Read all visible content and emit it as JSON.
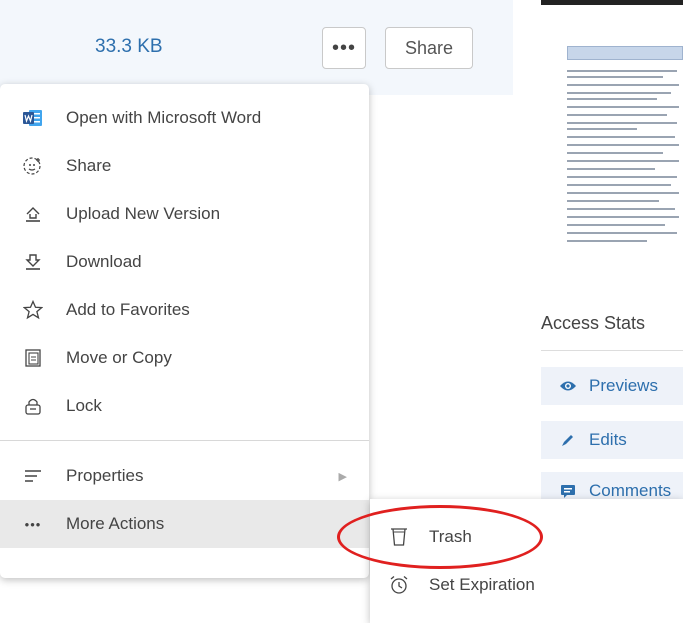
{
  "header": {
    "file_size": "33.3 KB",
    "more_label": "•••",
    "share_label": "Share"
  },
  "menu": {
    "items": [
      {
        "label": "Open with Microsoft Word",
        "icon": "word-icon"
      },
      {
        "label": "Share",
        "icon": "share-people-icon"
      },
      {
        "label": "Upload New Version",
        "icon": "upload-icon"
      },
      {
        "label": "Download",
        "icon": "download-icon"
      },
      {
        "label": "Add to Favorites",
        "icon": "star-icon"
      },
      {
        "label": "Move or Copy",
        "icon": "move-copy-icon"
      },
      {
        "label": "Lock",
        "icon": "lock-icon"
      }
    ],
    "properties_label": "Properties",
    "more_actions_label": "More Actions",
    "more_actions_icon": "•••"
  },
  "submenu": {
    "items": [
      {
        "label": "Trash",
        "icon": "trash-icon"
      },
      {
        "label": "Set Expiration",
        "icon": "alarm-clock-icon"
      }
    ]
  },
  "access_stats": {
    "title": "Access Stats",
    "items": [
      {
        "label": "Previews",
        "icon": "eye-icon"
      },
      {
        "label": "Edits",
        "icon": "pencil-icon"
      },
      {
        "label": "Comments",
        "icon": "comment-icon"
      }
    ]
  },
  "colors": {
    "accent": "#2d6fad",
    "header_bg": "#f3f7fc",
    "highlight": "#e0201f",
    "word_blue": "#2b5797"
  }
}
